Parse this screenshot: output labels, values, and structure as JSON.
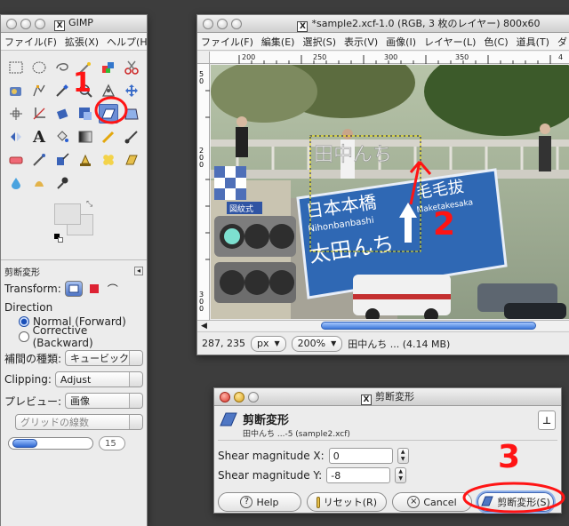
{
  "toolbox": {
    "title": "GIMP",
    "menu": [
      "ファイル(F)",
      "拡張(X)",
      "ヘルプ(H)"
    ],
    "tool_options": {
      "header": "剪断変形",
      "transform_label": "Transform:",
      "direction_label": "Direction",
      "direction_normal": "Normal (Forward)",
      "direction_corrective": "Corrective (Backward)",
      "interp_label": "補間の種類:",
      "interp_value": "キュービック",
      "clipping_label": "Clipping:",
      "clipping_value": "Adjust",
      "preview_label": "プレビュー:",
      "preview_value": "画像",
      "grid_value": "グリッドの線数",
      "grid_count": "15"
    }
  },
  "image_window": {
    "title": "*sample2.xcf-1.0 (RGB, 3 枚のレイヤー) 800x60",
    "menu": [
      "ファイル(F)",
      "編集(E)",
      "選択(S)",
      "表示(V)",
      "画像(I)",
      "レイヤー(L)",
      "色(C)",
      "道具(T)",
      "ダ"
    ],
    "ruler_h": [
      "200",
      "250",
      "300",
      "350",
      "4"
    ],
    "ruler_v": [
      "5",
      "0",
      "2",
      "0",
      "0",
      "3",
      "0",
      "0"
    ],
    "canvas_text": {
      "sign_line1": "日本本橋",
      "sign_line2": "Nihonbanbashi",
      "sign_line3": "太田んち",
      "sign_right1": "毛毛拔",
      "sign_right2": "Maketakesaka",
      "overlay": "田中んち",
      "small_sign": "図紋式"
    },
    "status": {
      "coords": "287, 235",
      "unit": "px",
      "zoom": "200%",
      "layer_info": "田中んち ... (4.14 MB)"
    }
  },
  "shear_dialog": {
    "title": "剪断変形",
    "heading": "剪断変形",
    "subheading": "田中んち ...-5 (sample2.xcf)",
    "shear_x_label": "Shear magnitude X:",
    "shear_x_value": "0",
    "shear_y_label": "Shear magnitude Y:",
    "shear_y_value": "-8",
    "help_label": "Help",
    "reset_label": "リセット(R)",
    "cancel_label": "Cancel",
    "ok_label": "剪断変形(S)"
  },
  "annotations": [
    "1",
    "2",
    "3"
  ]
}
